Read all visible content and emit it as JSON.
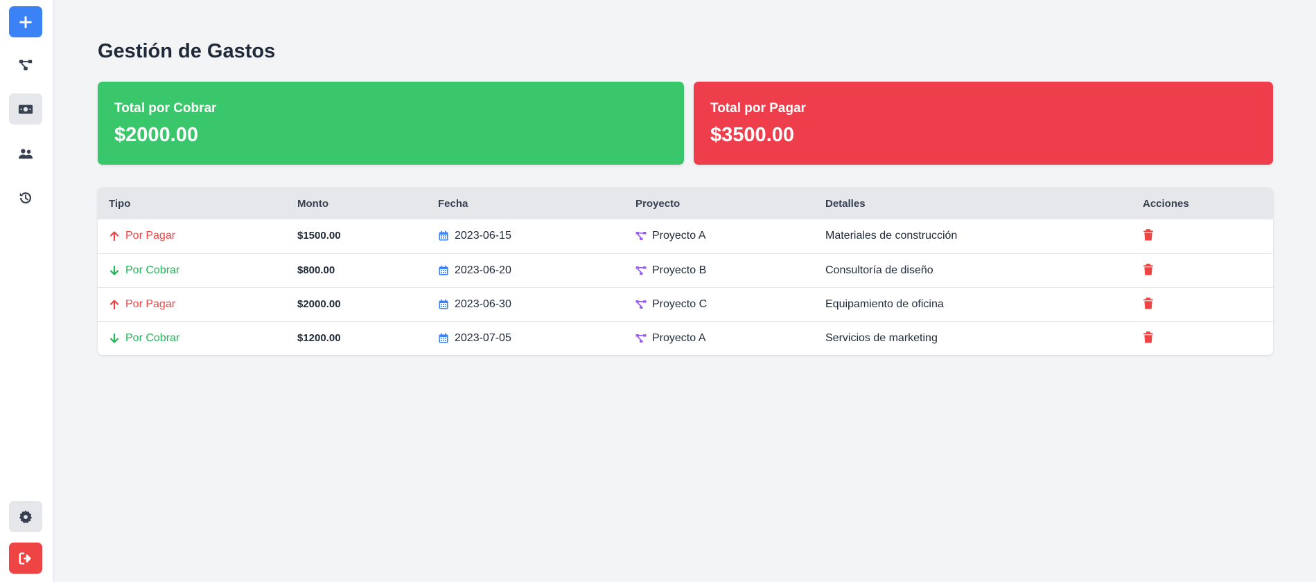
{
  "sidebar": {
    "items": [
      {
        "icon": "plus-icon"
      },
      {
        "icon": "project-tree-icon"
      },
      {
        "icon": "money-bill-icon"
      },
      {
        "icon": "users-icon"
      },
      {
        "icon": "history-icon"
      }
    ],
    "bottom": [
      {
        "icon": "gear-icon"
      },
      {
        "icon": "logout-icon"
      }
    ]
  },
  "page": {
    "title": "Gestión de Gastos"
  },
  "summary": {
    "cobrar_label": "Total por Cobrar",
    "cobrar_value": "$2000.00",
    "pagar_label": "Total por Pagar",
    "pagar_value": "$3500.00"
  },
  "colors": {
    "accent": "#3b82f6",
    "cobrar": "#3ac66a",
    "pagar": "#ef3e4b",
    "project_icon": "#9b59f6"
  },
  "table": {
    "headers": [
      "Tipo",
      "Monto",
      "Fecha",
      "Proyecto",
      "Detalles",
      "Acciones"
    ],
    "rows": [
      {
        "tipo": "Por Pagar",
        "monto": "$1500.00",
        "fecha": "2023-06-15",
        "proyecto": "Proyecto A",
        "detalles": "Materiales de construcción"
      },
      {
        "tipo": "Por Cobrar",
        "monto": "$800.00",
        "fecha": "2023-06-20",
        "proyecto": "Proyecto B",
        "detalles": "Consultoría de diseño"
      },
      {
        "tipo": "Por Pagar",
        "monto": "$2000.00",
        "fecha": "2023-06-30",
        "proyecto": "Proyecto C",
        "detalles": "Equipamiento de oficina"
      },
      {
        "tipo": "Por Cobrar",
        "monto": "$1200.00",
        "fecha": "2023-07-05",
        "proyecto": "Proyecto A",
        "detalles": "Servicios de marketing"
      }
    ]
  }
}
